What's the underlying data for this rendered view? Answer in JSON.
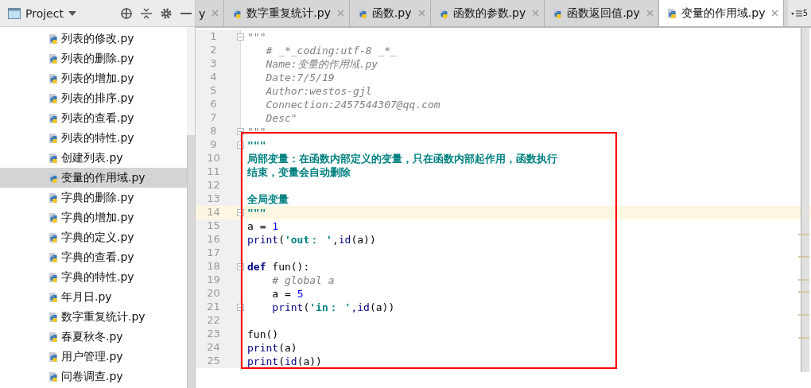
{
  "sidebar": {
    "title": "Project",
    "items": [
      {
        "label": "列表的修改.py",
        "selected": false
      },
      {
        "label": "列表的删除.py",
        "selected": false
      },
      {
        "label": "列表的增加.py",
        "selected": false
      },
      {
        "label": "列表的排序.py",
        "selected": false
      },
      {
        "label": "列表的查看.py",
        "selected": false
      },
      {
        "label": "列表的特性.py",
        "selected": false
      },
      {
        "label": "创建列表.py",
        "selected": false
      },
      {
        "label": "变量的作用域.py",
        "selected": true
      },
      {
        "label": "字典的删除.py",
        "selected": false
      },
      {
        "label": "字典的增加.py",
        "selected": false
      },
      {
        "label": "字典的定义.py",
        "selected": false
      },
      {
        "label": "字典的查看.py",
        "selected": false
      },
      {
        "label": "字典的特性.py",
        "selected": false
      },
      {
        "label": "年月日.py",
        "selected": false
      },
      {
        "label": "数字重复统计.py",
        "selected": false
      },
      {
        "label": "春夏秋冬.py",
        "selected": false
      },
      {
        "label": "用户管理.py",
        "selected": false
      },
      {
        "label": "问卷调查.py",
        "selected": false
      }
    ]
  },
  "tabs": [
    {
      "label": "y",
      "selected": false,
      "partial": true
    },
    {
      "label": "数字重复统计.py",
      "selected": false,
      "partial": false
    },
    {
      "label": "函数.py",
      "selected": false,
      "partial": false
    },
    {
      "label": "函数的参数.py",
      "selected": false,
      "partial": false
    },
    {
      "label": "函数返回值.py",
      "selected": false,
      "partial": false
    },
    {
      "label": "变量的作用域.py",
      "selected": true,
      "partial": false
    }
  ],
  "tab_overflow": {
    "count": "5"
  },
  "editor": {
    "lines": [
      {
        "number": "1",
        "fold": true,
        "current": false,
        "tokens": [
          {
            "t": "\"\"\"",
            "kind": "docq"
          }
        ]
      },
      {
        "number": "2",
        "fold": false,
        "current": false,
        "tokens": [
          {
            "t": "   # _*_coding:utf-8 _*_",
            "kind": "doc"
          }
        ]
      },
      {
        "number": "3",
        "fold": false,
        "current": false,
        "tokens": [
          {
            "t": "   Name:变量的作用域.py",
            "kind": "doc"
          }
        ]
      },
      {
        "number": "4",
        "fold": false,
        "current": false,
        "tokens": [
          {
            "t": "   Date:7/5/19",
            "kind": "doc"
          }
        ]
      },
      {
        "number": "5",
        "fold": false,
        "current": false,
        "tokens": [
          {
            "t": "   Author:westos-gjl",
            "kind": "doc"
          }
        ]
      },
      {
        "number": "6",
        "fold": false,
        "current": false,
        "tokens": [
          {
            "t": "   Connection:2457544307@qq.com",
            "kind": "doc"
          }
        ]
      },
      {
        "number": "7",
        "fold": false,
        "current": false,
        "tokens": [
          {
            "t": "   Desc\"",
            "kind": "doc"
          }
        ]
      },
      {
        "number": "8",
        "fold": true,
        "current": false,
        "tokens": [
          {
            "t": "\"\"\"",
            "kind": "docq"
          }
        ]
      },
      {
        "number": "9",
        "fold": true,
        "current": false,
        "tokens": [
          {
            "t": "\"\"\"",
            "kind": "str"
          }
        ]
      },
      {
        "number": "10",
        "fold": false,
        "current": false,
        "tokens": [
          {
            "t": "局部变量：在函数内部定义的变量，只在函数内部起作用，函数执行",
            "kind": "str"
          }
        ]
      },
      {
        "number": "11",
        "fold": false,
        "current": false,
        "tokens": [
          {
            "t": "结束，变量会自动删除",
            "kind": "str"
          }
        ]
      },
      {
        "number": "12",
        "fold": false,
        "current": false
      },
      {
        "number": "13",
        "fold": false,
        "current": false,
        "tokens": [
          {
            "t": "全局变量",
            "kind": "str"
          }
        ]
      },
      {
        "number": "14",
        "fold": true,
        "current": true,
        "tokens": [
          {
            "t": "\"\"\"",
            "kind": "str"
          }
        ]
      },
      {
        "number": "15",
        "fold": false,
        "current": false,
        "tokens": [
          {
            "t": "a = ",
            "kind": "plain"
          },
          {
            "t": "1",
            "kind": "num"
          }
        ]
      },
      {
        "number": "16",
        "fold": false,
        "current": false,
        "tokens": [
          {
            "t": "print",
            "kind": "builtin"
          },
          {
            "t": "(",
            "kind": "plain"
          },
          {
            "t": "'out： '",
            "kind": "str"
          },
          {
            "t": ",",
            "kind": "plain"
          },
          {
            "t": "id",
            "kind": "builtin"
          },
          {
            "t": "(a))",
            "kind": "plain"
          }
        ]
      },
      {
        "number": "17",
        "fold": false,
        "current": false
      },
      {
        "number": "18",
        "fold": true,
        "current": false,
        "tokens": [
          {
            "t": "def",
            "kind": "kw"
          },
          {
            "t": " fun():",
            "kind": "plain"
          }
        ]
      },
      {
        "number": "19",
        "fold": false,
        "current": false,
        "tokens": [
          {
            "t": "    # global a",
            "kind": "comment"
          }
        ]
      },
      {
        "number": "20",
        "fold": false,
        "current": false,
        "tokens": [
          {
            "t": "    a = ",
            "kind": "plain"
          },
          {
            "t": "5",
            "kind": "num"
          }
        ]
      },
      {
        "number": "21",
        "fold": true,
        "current": false,
        "tokens": [
          {
            "t": "    print",
            "kind": "builtin"
          },
          {
            "t": "(",
            "kind": "plain"
          },
          {
            "t": "'in： '",
            "kind": "str"
          },
          {
            "t": ",id",
            "kind": "builtin"
          },
          {
            "t": "(a))",
            "kind": "plain"
          }
        ]
      },
      {
        "number": "22",
        "fold": false,
        "current": false
      },
      {
        "number": "23",
        "fold": false,
        "current": false,
        "tokens": [
          {
            "t": "fun()",
            "kind": "plain"
          }
        ]
      },
      {
        "number": "24",
        "fold": false,
        "current": false,
        "tokens": [
          {
            "t": "print",
            "kind": "builtin"
          },
          {
            "t": "(a)",
            "kind": "plain"
          }
        ]
      },
      {
        "number": "25",
        "fold": false,
        "current": false,
        "tokens": [
          {
            "t": "print",
            "kind": "builtin"
          },
          {
            "t": "(",
            "kind": "plain"
          },
          {
            "t": "id",
            "kind": "builtin"
          },
          {
            "t": "(a))",
            "kind": "plain"
          }
        ]
      }
    ]
  }
}
